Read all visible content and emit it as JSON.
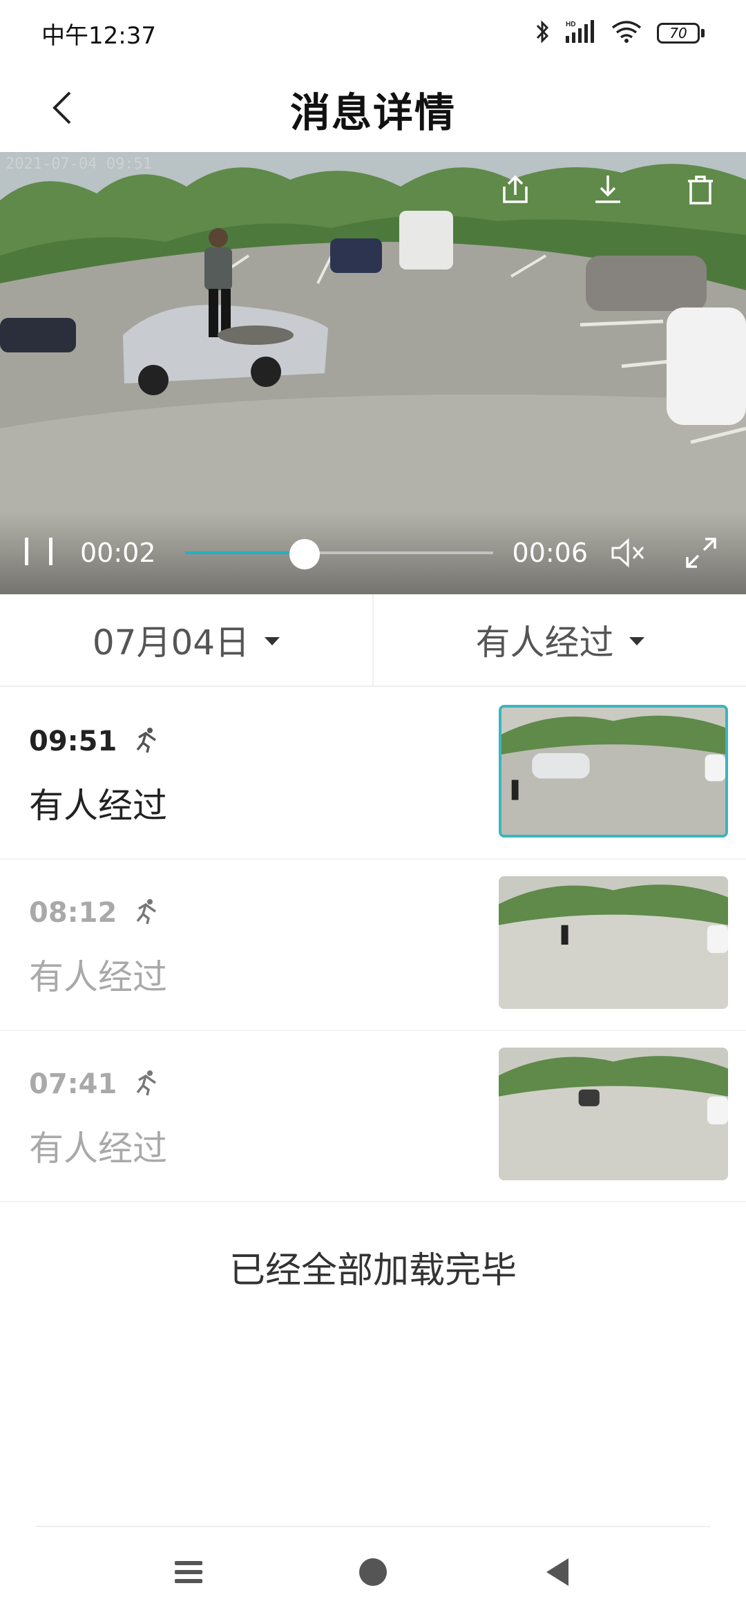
{
  "status_bar": {
    "time": "中午12:37",
    "battery_level": "70",
    "icons": [
      "bluetooth-icon",
      "hd-signal-icon",
      "wifi-icon",
      "battery-icon"
    ]
  },
  "header": {
    "title": "消息详情",
    "back_icon": "chevron-left-icon"
  },
  "video": {
    "current_time": "00:02",
    "duration": "00:06",
    "progress_fraction": 0.39,
    "accent_color": "#1fb3c4",
    "top_icons": [
      "share-icon",
      "download-icon",
      "trash-icon"
    ],
    "control_icons": [
      "pause-icon",
      "mute-icon",
      "fullscreen-icon"
    ]
  },
  "filters": {
    "date": "07月04日",
    "event_type": "有人经过"
  },
  "events": [
    {
      "time": "09:51",
      "label": "有人经过",
      "icon": "running-person-icon",
      "selected": true
    },
    {
      "time": "08:12",
      "label": "有人经过",
      "icon": "running-person-icon",
      "selected": false
    },
    {
      "time": "07:41",
      "label": "有人经过",
      "icon": "running-person-icon",
      "selected": false
    }
  ],
  "footer_message": "已经全部加载完毕",
  "nav": {
    "icons": [
      "menu-icon",
      "home-icon",
      "back-icon"
    ]
  }
}
